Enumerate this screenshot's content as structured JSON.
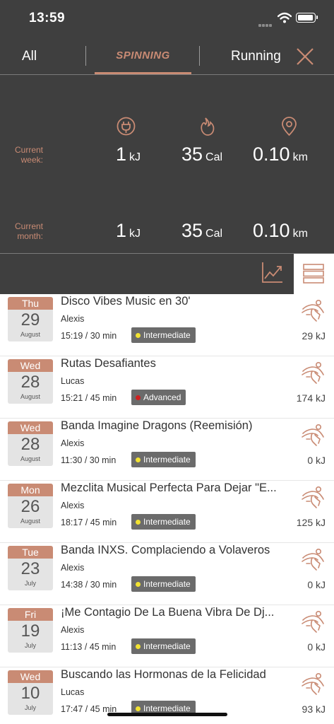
{
  "status_bar": {
    "time": "13:59"
  },
  "tabs": {
    "all": "All",
    "spinning": "SPINNING",
    "running": "Running"
  },
  "stats": {
    "week_label": "Current week:",
    "month_label": "Current month:",
    "week": {
      "energy": "1",
      "energy_unit": "kJ",
      "calories": "35",
      "calories_unit": "Cal",
      "distance": "0.10",
      "distance_unit": "km"
    },
    "month": {
      "energy": "1",
      "energy_unit": "kJ",
      "calories": "35",
      "calories_unit": "Cal",
      "distance": "0.10",
      "distance_unit": "km"
    }
  },
  "colors": {
    "accent": "#c98b74",
    "dark_bg": "#3f3f3f",
    "intermediate": "#f2e231",
    "advanced": "#d01f1f"
  },
  "classes": [
    {
      "day": "Thu",
      "date": "29",
      "month": "August",
      "title": "Disco Vibes Music en 30'",
      "instructor": "Alexis",
      "time_duration": "15:19 / 30 min",
      "level": "Intermediate",
      "level_color": "#f2e231",
      "energy": "29 kJ"
    },
    {
      "day": "Wed",
      "date": "28",
      "month": "August",
      "title": "Rutas Desafiantes",
      "instructor": "Lucas",
      "time_duration": "15:21 / 45 min",
      "level": "Advanced",
      "level_color": "#d01f1f",
      "energy": "174 kJ"
    },
    {
      "day": "Wed",
      "date": "28",
      "month": "August",
      "title": "Banda Imagine Dragons (Reemisión)",
      "instructor": "Alexis",
      "time_duration": "11:30 / 30 min",
      "level": "Intermediate",
      "level_color": "#f2e231",
      "energy": "0 kJ"
    },
    {
      "day": "Mon",
      "date": "26",
      "month": "August",
      "title": "Mezclita Musical Perfecta Para Dejar \"E...",
      "instructor": "Alexis",
      "time_duration": "18:17 / 45 min",
      "level": "Intermediate",
      "level_color": "#f2e231",
      "energy": "125 kJ"
    },
    {
      "day": "Tue",
      "date": "23",
      "month": "July",
      "title": "Banda INXS. Complaciendo a Volaveros",
      "instructor": "Alexis",
      "time_duration": "14:38 / 30 min",
      "level": "Intermediate",
      "level_color": "#f2e231",
      "energy": "0 kJ"
    },
    {
      "day": "Fri",
      "date": "19",
      "month": "July",
      "title": "¡Me Contagio De La Buena Vibra De Dj...",
      "instructor": "Alexis",
      "time_duration": "11:13 / 45 min",
      "level": "Intermediate",
      "level_color": "#f2e231",
      "energy": "0 kJ"
    },
    {
      "day": "Wed",
      "date": "10",
      "month": "July",
      "title": "Buscando las Hormonas de la Felicidad",
      "instructor": "Lucas",
      "time_duration": "17:47 / 45 min",
      "level": "Intermediate",
      "level_color": "#f2e231",
      "energy": "93 kJ"
    }
  ]
}
